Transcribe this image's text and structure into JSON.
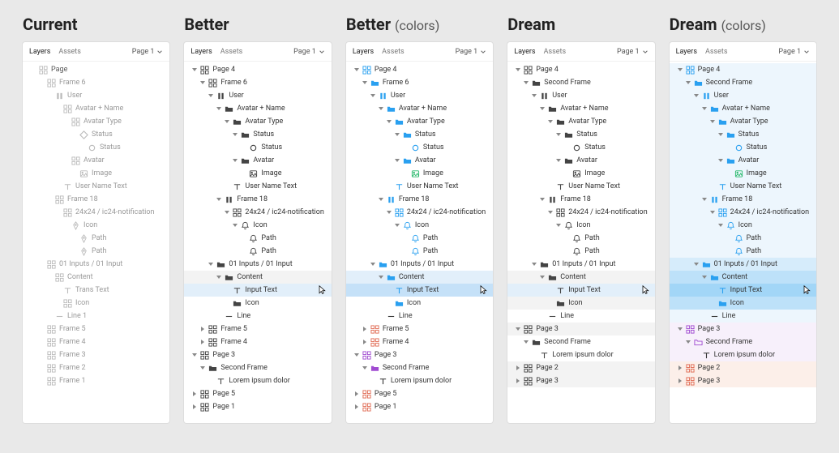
{
  "icons": {
    "grid": "<svg viewBox='0 0 12 12' fill='none' stroke='currentColor' stroke-width='1'><rect x='1' y='1' width='4' height='4'/><rect x='7' y='1' width='4' height='4'/><rect x='1' y='7' width='4' height='4'/><rect x='7' y='7' width='4' height='4'/></svg>",
    "pause": "<svg viewBox='0 0 12 12' fill='currentColor'><rect x='2.5' y='2' width='2.5' height='8'/><rect x='7' y='2' width='2.5' height='8'/></svg>",
    "folder": "<svg viewBox='0 0 12 12' fill='currentColor'><path d='M1 3h3l1 1.4h6v5.1H1z'/></svg>",
    "folder-o": "<svg viewBox='0 0 12 12' fill='none' stroke='currentColor' stroke-width='1'><path d='M1 3h3l1 1.4h6v5.1H1z'/></svg>",
    "diamond": "<svg viewBox='0 0 12 12' fill='none' stroke='currentColor' stroke-width='1.2'><path d='M6 1 L11 6 L6 11 L1 6 Z'/></svg>",
    "circle": "<svg viewBox='0 0 12 12' fill='none' stroke='currentColor' stroke-width='1.2'><circle cx='6' cy='6' r='3.5'/></svg>",
    "image": "<svg viewBox='0 0 12 12' fill='none' stroke='currentColor' stroke-width='1'><rect x='1.5' y='2' width='9' height='8' rx='1'/><circle cx='4' cy='4.5' r='0.8' fill='currentColor'/><path d='M2 9l2.5-2.5 2 2 2-3 2 3.5'/></svg>",
    "text": "<svg viewBox='0 0 12 12' fill='none' stroke='currentColor' stroke-width='1.2'><path d='M2 3h8M6 3v7'/></svg>",
    "pen": "<svg viewBox='0 0 12 12' fill='none' stroke='currentColor' stroke-width='1'><path d='M6 1l3 4-3 6-3-6z'/><circle cx='6' cy='5' r='0.8' fill='currentColor'/></svg>",
    "bell": "<svg viewBox='0 0 12 12' fill='none' stroke='currentColor' stroke-width='1'><path d='M6 1.5c-1.7 0-3 1.3-3 3v2l-1 1.5h8L9 6.5v-2c0-1.7-1.3-3-3-3z'/><path d='M5 9.5a1 1 0 0 0 2 0'/></svg>",
    "line": "<svg viewBox='0 0 12 12' stroke='currentColor' stroke-width='1.2'><path d='M2 6h8'/></svg>",
    "cursor": "<svg viewBox='0 0 16 16' fill='#fff' stroke='#000' stroke-width='1'><path d='M4 1v12l3-3 2 4 2-1-2-4h4z'/></svg>",
    "chevdown": "<svg viewBox='0 0 10 10' fill='none' stroke='currentColor' stroke-width='1.3'><path d='M2 3.5l3 3 3-3'/></svg>"
  },
  "header": {
    "tab_layers": "Layers",
    "tab_assets": "Assets",
    "page_sel": "Page 1"
  },
  "columns": [
    {
      "id": "current",
      "title": "Current",
      "subtitle": "",
      "variant": "current",
      "rows": [
        {
          "d": 0,
          "t": "",
          "i": "grid",
          "l": "Page",
          "first": true
        },
        {
          "d": 1,
          "t": "",
          "i": "grid",
          "l": "Frame 6"
        },
        {
          "d": 2,
          "t": "",
          "i": "pause",
          "l": "User"
        },
        {
          "d": 3,
          "t": "",
          "i": "grid",
          "l": "Avatar + Name"
        },
        {
          "d": 4,
          "t": "",
          "i": "grid",
          "l": "Avatar Type"
        },
        {
          "d": 5,
          "t": "",
          "i": "diamond",
          "l": "Status"
        },
        {
          "d": 6,
          "t": "",
          "i": "circle",
          "l": "Status"
        },
        {
          "d": 4,
          "t": "",
          "i": "grid",
          "l": "Avatar"
        },
        {
          "d": 5,
          "t": "",
          "i": "image",
          "l": "Image"
        },
        {
          "d": 3,
          "t": "",
          "i": "text",
          "l": "User Name Text"
        },
        {
          "d": 2,
          "t": "",
          "i": "grid",
          "l": "Frame 18"
        },
        {
          "d": 3,
          "t": "",
          "i": "grid",
          "l": "24x24 / ic24-notification"
        },
        {
          "d": 4,
          "t": "",
          "i": "pen",
          "l": "Icon"
        },
        {
          "d": 5,
          "t": "",
          "i": "pen",
          "l": "Path"
        },
        {
          "d": 5,
          "t": "",
          "i": "pen",
          "l": "Path"
        },
        {
          "d": 1,
          "t": "",
          "i": "grid",
          "l": "01 Inputs / 01 Input"
        },
        {
          "d": 2,
          "t": "",
          "i": "grid",
          "l": "Content"
        },
        {
          "d": 3,
          "t": "",
          "i": "text",
          "l": "Trans Text"
        },
        {
          "d": 3,
          "t": "",
          "i": "grid",
          "l": "Icon"
        },
        {
          "d": 2,
          "t": "",
          "i": "line",
          "l": "Line 1"
        },
        {
          "d": 1,
          "t": "",
          "i": "grid",
          "l": "Frame 5"
        },
        {
          "d": 1,
          "t": "",
          "i": "grid",
          "l": "Frame 4"
        },
        {
          "d": 1,
          "t": "",
          "i": "grid",
          "l": "Frame 3"
        },
        {
          "d": 1,
          "t": "",
          "i": "grid",
          "l": "Frame 2"
        },
        {
          "d": 1,
          "t": "",
          "i": "grid",
          "l": "Frame 1"
        }
      ]
    },
    {
      "id": "better",
      "title": "Better",
      "subtitle": "",
      "variant": "mono",
      "rows": [
        {
          "d": 0,
          "t": "down",
          "i": "grid",
          "l": "Page 4"
        },
        {
          "d": 1,
          "t": "down",
          "i": "grid",
          "l": "Frame 6"
        },
        {
          "d": 2,
          "t": "down",
          "i": "pause",
          "l": "User"
        },
        {
          "d": 3,
          "t": "down",
          "i": "folder",
          "l": "Avatar + Name"
        },
        {
          "d": 4,
          "t": "down",
          "i": "folder",
          "l": "Avatar Type"
        },
        {
          "d": 5,
          "t": "down",
          "i": "folder",
          "l": "Status"
        },
        {
          "d": 6,
          "t": "",
          "i": "circle",
          "l": "Status"
        },
        {
          "d": 5,
          "t": "down",
          "i": "folder",
          "l": "Avatar"
        },
        {
          "d": 6,
          "t": "",
          "i": "image",
          "l": "Image"
        },
        {
          "d": 4,
          "t": "",
          "i": "text",
          "l": "User Name Text"
        },
        {
          "d": 3,
          "t": "down",
          "i": "pause",
          "l": "Frame 18"
        },
        {
          "d": 4,
          "t": "down",
          "i": "grid",
          "l": "24x24 / ic24-notification"
        },
        {
          "d": 5,
          "t": "down",
          "i": "bell",
          "l": "Icon"
        },
        {
          "d": 6,
          "t": "",
          "i": "bell",
          "l": "Path"
        },
        {
          "d": 6,
          "t": "",
          "i": "bell",
          "l": "Path"
        },
        {
          "d": 2,
          "t": "down",
          "i": "folder",
          "l": "01 Inputs / 01 Input"
        },
        {
          "d": 3,
          "t": "down",
          "i": "folder",
          "l": "Content",
          "hl": true
        },
        {
          "d": 4,
          "t": "",
          "i": "text",
          "l": "Input Text",
          "sel": true,
          "cursor": true
        },
        {
          "d": 4,
          "t": "",
          "i": "folder",
          "l": "Icon"
        },
        {
          "d": 3,
          "t": "",
          "i": "line",
          "l": "Line"
        },
        {
          "d": 1,
          "t": "right",
          "i": "grid",
          "l": "Frame 5"
        },
        {
          "d": 1,
          "t": "right",
          "i": "grid",
          "l": "Frame 4"
        },
        {
          "d": 0,
          "t": "down",
          "i": "grid",
          "l": "Page 3"
        },
        {
          "d": 1,
          "t": "down",
          "i": "folder",
          "l": "Second Frame"
        },
        {
          "d": 2,
          "t": "",
          "i": "text",
          "l": "Lorem ipsum dolor"
        },
        {
          "d": 0,
          "t": "right",
          "i": "grid",
          "l": "Page 5"
        },
        {
          "d": 0,
          "t": "right",
          "i": "grid",
          "l": "Page 1"
        }
      ]
    },
    {
      "id": "better-c",
      "title": "Better",
      "subtitle": "(colors)",
      "variant": "color",
      "rows": [
        {
          "d": 0,
          "t": "down",
          "i": "grid",
          "l": "Page 4",
          "c": "#2aa0f0"
        },
        {
          "d": 1,
          "t": "down",
          "i": "folder",
          "l": "Frame 6",
          "c": "#2aa0f0"
        },
        {
          "d": 2,
          "t": "down",
          "i": "pause",
          "l": "User",
          "c": "#2aa0f0"
        },
        {
          "d": 3,
          "t": "down",
          "i": "folder",
          "l": "Avatar + Name",
          "c": "#2aa0f0"
        },
        {
          "d": 4,
          "t": "down",
          "i": "folder",
          "l": "Avatar Type",
          "c": "#2aa0f0"
        },
        {
          "d": 5,
          "t": "down",
          "i": "folder",
          "l": "Status",
          "c": "#2aa0f0"
        },
        {
          "d": 6,
          "t": "",
          "i": "circle",
          "l": "Status",
          "c": "#2aa0f0"
        },
        {
          "d": 5,
          "t": "down",
          "i": "folder",
          "l": "Avatar",
          "c": "#2aa0f0"
        },
        {
          "d": 6,
          "t": "",
          "i": "image",
          "l": "Image",
          "c": "#29b96c"
        },
        {
          "d": 4,
          "t": "",
          "i": "text",
          "l": "User Name Text",
          "c": "#2aa0f0"
        },
        {
          "d": 3,
          "t": "down",
          "i": "pause",
          "l": "Frame 18",
          "c": "#2aa0f0"
        },
        {
          "d": 4,
          "t": "down",
          "i": "grid",
          "l": "24x24 / ic24-notification",
          "c": "#2aa0f0"
        },
        {
          "d": 5,
          "t": "down",
          "i": "bell",
          "l": "Icon",
          "c": "#2aa0f0"
        },
        {
          "d": 6,
          "t": "",
          "i": "bell",
          "l": "Path",
          "c": "#2aa0f0"
        },
        {
          "d": 6,
          "t": "",
          "i": "bell",
          "l": "Path",
          "c": "#2aa0f0"
        },
        {
          "d": 2,
          "t": "down",
          "i": "folder",
          "l": "01 Inputs / 01 Input",
          "c": "#2aa0f0"
        },
        {
          "d": 3,
          "t": "down",
          "i": "folder",
          "l": "Content",
          "c": "#2aa0f0",
          "sel": true
        },
        {
          "d": 4,
          "t": "",
          "i": "text",
          "l": "Input Text",
          "c": "#2aa0f0",
          "sel2": true,
          "cursor": true
        },
        {
          "d": 4,
          "t": "",
          "i": "folder",
          "l": "Icon",
          "c": "#2aa0f0"
        },
        {
          "d": 3,
          "t": "",
          "i": "line",
          "l": "Line"
        },
        {
          "d": 1,
          "t": "right",
          "i": "grid",
          "l": "Frame 5",
          "c": "#e06a52"
        },
        {
          "d": 1,
          "t": "right",
          "i": "grid",
          "l": "Frame 4",
          "c": "#e06a52"
        },
        {
          "d": 0,
          "t": "down",
          "i": "grid",
          "l": "Page 3",
          "c": "#a04bd1"
        },
        {
          "d": 1,
          "t": "down",
          "i": "folder",
          "l": "Second Frame",
          "c": "#a04bd1"
        },
        {
          "d": 2,
          "t": "",
          "i": "text",
          "l": "Lorem ipsum dolor"
        },
        {
          "d": 0,
          "t": "right",
          "i": "grid",
          "l": "Page 5",
          "c": "#e06a52"
        },
        {
          "d": 0,
          "t": "right",
          "i": "grid",
          "l": "Page 1",
          "c": "#e06a52"
        }
      ]
    },
    {
      "id": "dream",
      "title": "Dream",
      "subtitle": "",
      "variant": "mono",
      "rows": [
        {
          "d": 0,
          "t": "down",
          "i": "grid",
          "l": "Page 4"
        },
        {
          "d": 1,
          "t": "down",
          "i": "folder",
          "l": "Second Frame"
        },
        {
          "d": 2,
          "t": "down",
          "i": "pause",
          "l": "User"
        },
        {
          "d": 3,
          "t": "down",
          "i": "folder",
          "l": "Avatar + Name"
        },
        {
          "d": 4,
          "t": "down",
          "i": "folder",
          "l": "Avatar Type"
        },
        {
          "d": 5,
          "t": "down",
          "i": "folder",
          "l": "Status"
        },
        {
          "d": 6,
          "t": "",
          "i": "circle",
          "l": "Status"
        },
        {
          "d": 5,
          "t": "down",
          "i": "folder",
          "l": "Avatar"
        },
        {
          "d": 6,
          "t": "",
          "i": "image",
          "l": "Image"
        },
        {
          "d": 4,
          "t": "",
          "i": "text",
          "l": "User Name Text"
        },
        {
          "d": 3,
          "t": "down",
          "i": "pause",
          "l": "Frame 18"
        },
        {
          "d": 4,
          "t": "down",
          "i": "grid",
          "l": "24x24 / ic24-notification"
        },
        {
          "d": 5,
          "t": "down",
          "i": "bell",
          "l": "Icon"
        },
        {
          "d": 6,
          "t": "",
          "i": "bell",
          "l": "Path"
        },
        {
          "d": 6,
          "t": "",
          "i": "bell",
          "l": "Path"
        },
        {
          "d": 2,
          "t": "down",
          "i": "folder",
          "l": "01 Inputs / 01 Input"
        },
        {
          "d": 3,
          "t": "down",
          "i": "folder",
          "l": "Content",
          "hl": true
        },
        {
          "d": 4,
          "t": "",
          "i": "text",
          "l": "Input Text",
          "sel": true,
          "cursor": true
        },
        {
          "d": 4,
          "t": "",
          "i": "folder",
          "l": "Icon",
          "hl": true
        },
        {
          "d": 3,
          "t": "",
          "i": "line",
          "l": "Line"
        },
        {
          "d": 0,
          "t": "down",
          "i": "grid",
          "l": "Page 3",
          "hl": true
        },
        {
          "d": 1,
          "t": "down",
          "i": "folder",
          "l": "Second Frame"
        },
        {
          "d": 2,
          "t": "",
          "i": "text",
          "l": "Lorem ipsum dolor"
        },
        {
          "d": 0,
          "t": "right",
          "i": "grid",
          "l": "Page 2",
          "hl": true
        },
        {
          "d": 0,
          "t": "right",
          "i": "grid",
          "l": "Page 3",
          "hl": true
        }
      ]
    },
    {
      "id": "dream-c",
      "title": "Dream",
      "subtitle": "(colors)",
      "variant": "color",
      "rows": [
        {
          "d": 0,
          "t": "down",
          "i": "grid",
          "l": "Page 4",
          "c": "#2aa0f0",
          "bg": "#edf6fd"
        },
        {
          "d": 1,
          "t": "down",
          "i": "folder",
          "l": "Second Frame",
          "c": "#2aa0f0",
          "bg": "#edf6fd"
        },
        {
          "d": 2,
          "t": "down",
          "i": "pause",
          "l": "User",
          "c": "#2aa0f0",
          "bg": "#edf6fd"
        },
        {
          "d": 3,
          "t": "down",
          "i": "folder",
          "l": "Avatar + Name",
          "c": "#2aa0f0",
          "bg": "#edf6fd"
        },
        {
          "d": 4,
          "t": "down",
          "i": "folder",
          "l": "Avatar Type",
          "c": "#2aa0f0",
          "bg": "#edf6fd"
        },
        {
          "d": 5,
          "t": "down",
          "i": "folder",
          "l": "Status",
          "c": "#2aa0f0",
          "bg": "#edf6fd"
        },
        {
          "d": 6,
          "t": "",
          "i": "circle",
          "l": "Status",
          "c": "#2aa0f0",
          "bg": "#edf6fd"
        },
        {
          "d": 5,
          "t": "down",
          "i": "folder",
          "l": "Avatar",
          "c": "#2aa0f0",
          "bg": "#edf6fd"
        },
        {
          "d": 6,
          "t": "",
          "i": "image",
          "l": "Image",
          "c": "#29b96c",
          "bg": "#edf6fd"
        },
        {
          "d": 4,
          "t": "",
          "i": "text",
          "l": "User Name Text",
          "c": "#2aa0f0",
          "bg": "#edf6fd"
        },
        {
          "d": 3,
          "t": "down",
          "i": "pause",
          "l": "Frame 18",
          "c": "#2aa0f0",
          "bg": "#edf6fd"
        },
        {
          "d": 4,
          "t": "down",
          "i": "grid",
          "l": "24x24 / ic24-notification",
          "c": "#2aa0f0",
          "bg": "#edf6fd"
        },
        {
          "d": 5,
          "t": "down",
          "i": "bell",
          "l": "Icon",
          "c": "#2aa0f0",
          "bg": "#edf6fd"
        },
        {
          "d": 6,
          "t": "",
          "i": "bell",
          "l": "Path",
          "c": "#2aa0f0",
          "bg": "#edf6fd"
        },
        {
          "d": 6,
          "t": "",
          "i": "bell",
          "l": "Path",
          "c": "#2aa0f0",
          "bg": "#edf6fd"
        },
        {
          "d": 2,
          "t": "down",
          "i": "folder",
          "l": "01 Inputs / 01 Input",
          "c": "#2aa0f0",
          "bg": "#d6ecfb"
        },
        {
          "d": 3,
          "t": "down",
          "i": "folder",
          "l": "Content",
          "c": "#2aa0f0",
          "bg": "#bde1f9"
        },
        {
          "d": 4,
          "t": "",
          "i": "text",
          "l": "Input Text",
          "c": "#2aa0f0",
          "bg": "#a2d6f7",
          "cursor": true
        },
        {
          "d": 4,
          "t": "",
          "i": "folder",
          "l": "Icon",
          "c": "#2aa0f0",
          "bg": "#bde1f9"
        },
        {
          "d": 3,
          "t": "",
          "i": "line",
          "l": "Line",
          "bg": "#edf6fd"
        },
        {
          "d": 0,
          "t": "down",
          "i": "grid",
          "l": "Page 3",
          "c": "#a04bd1",
          "bg": "#f7f0fb"
        },
        {
          "d": 1,
          "t": "down",
          "i": "folder-o",
          "l": "Second Frame",
          "c": "#a04bd1",
          "bg": "#f7f0fb"
        },
        {
          "d": 2,
          "t": "",
          "i": "text",
          "l": "Lorem ipsum dolor",
          "bg": "#f7f0fb"
        },
        {
          "d": 0,
          "t": "right",
          "i": "grid",
          "l": "Page 2",
          "c": "#e06a52",
          "bg": "#fcefe9"
        },
        {
          "d": 0,
          "t": "right",
          "i": "grid",
          "l": "Page 3",
          "c": "#e06a52",
          "bg": "#fcefe9"
        }
      ]
    }
  ]
}
